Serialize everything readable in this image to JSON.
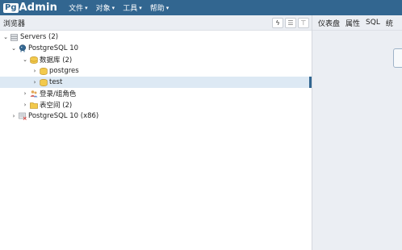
{
  "navbar": {
    "logo_box": "Pg",
    "logo_text": "Admin",
    "menus": [
      {
        "label": "文件",
        "caret": "▾"
      },
      {
        "label": "对象",
        "caret": "▾"
      },
      {
        "label": "工具",
        "caret": "▾"
      },
      {
        "label": "帮助",
        "caret": "▾"
      }
    ]
  },
  "browser": {
    "title": "浏览器",
    "tools": {
      "query": "ϟ",
      "view": "☰",
      "filter": "⊤"
    }
  },
  "tree": [
    {
      "toggle": "⌄",
      "label": "Servers (2)",
      "icon": "server-group-icon"
    },
    {
      "toggle": "⌄",
      "label": "PostgreSQL 10",
      "icon": "elephant-server-icon"
    },
    {
      "toggle": "⌄",
      "label": "数据库 (2)",
      "icon": "databases-icon"
    },
    {
      "toggle": "›",
      "label": "postgres",
      "icon": "database-icon"
    },
    {
      "toggle": "›",
      "label": "test",
      "icon": "database-icon",
      "selected": true
    },
    {
      "toggle": "›",
      "label": "登录/组角色",
      "icon": "roles-icon"
    },
    {
      "toggle": "›",
      "label": "表空间 (2)",
      "icon": "tablespaces-icon"
    },
    {
      "toggle": "›",
      "label": "PostgreSQL 10 (x86)",
      "icon": "server-disconnected-icon"
    }
  ],
  "right_panel": {
    "tabs": [
      "仪表盘",
      "属性",
      "SQL",
      "统"
    ]
  },
  "colors": {
    "navbar": "#326690",
    "selected_row": "#dde9f4",
    "panel_bg": "#ebeef3"
  }
}
